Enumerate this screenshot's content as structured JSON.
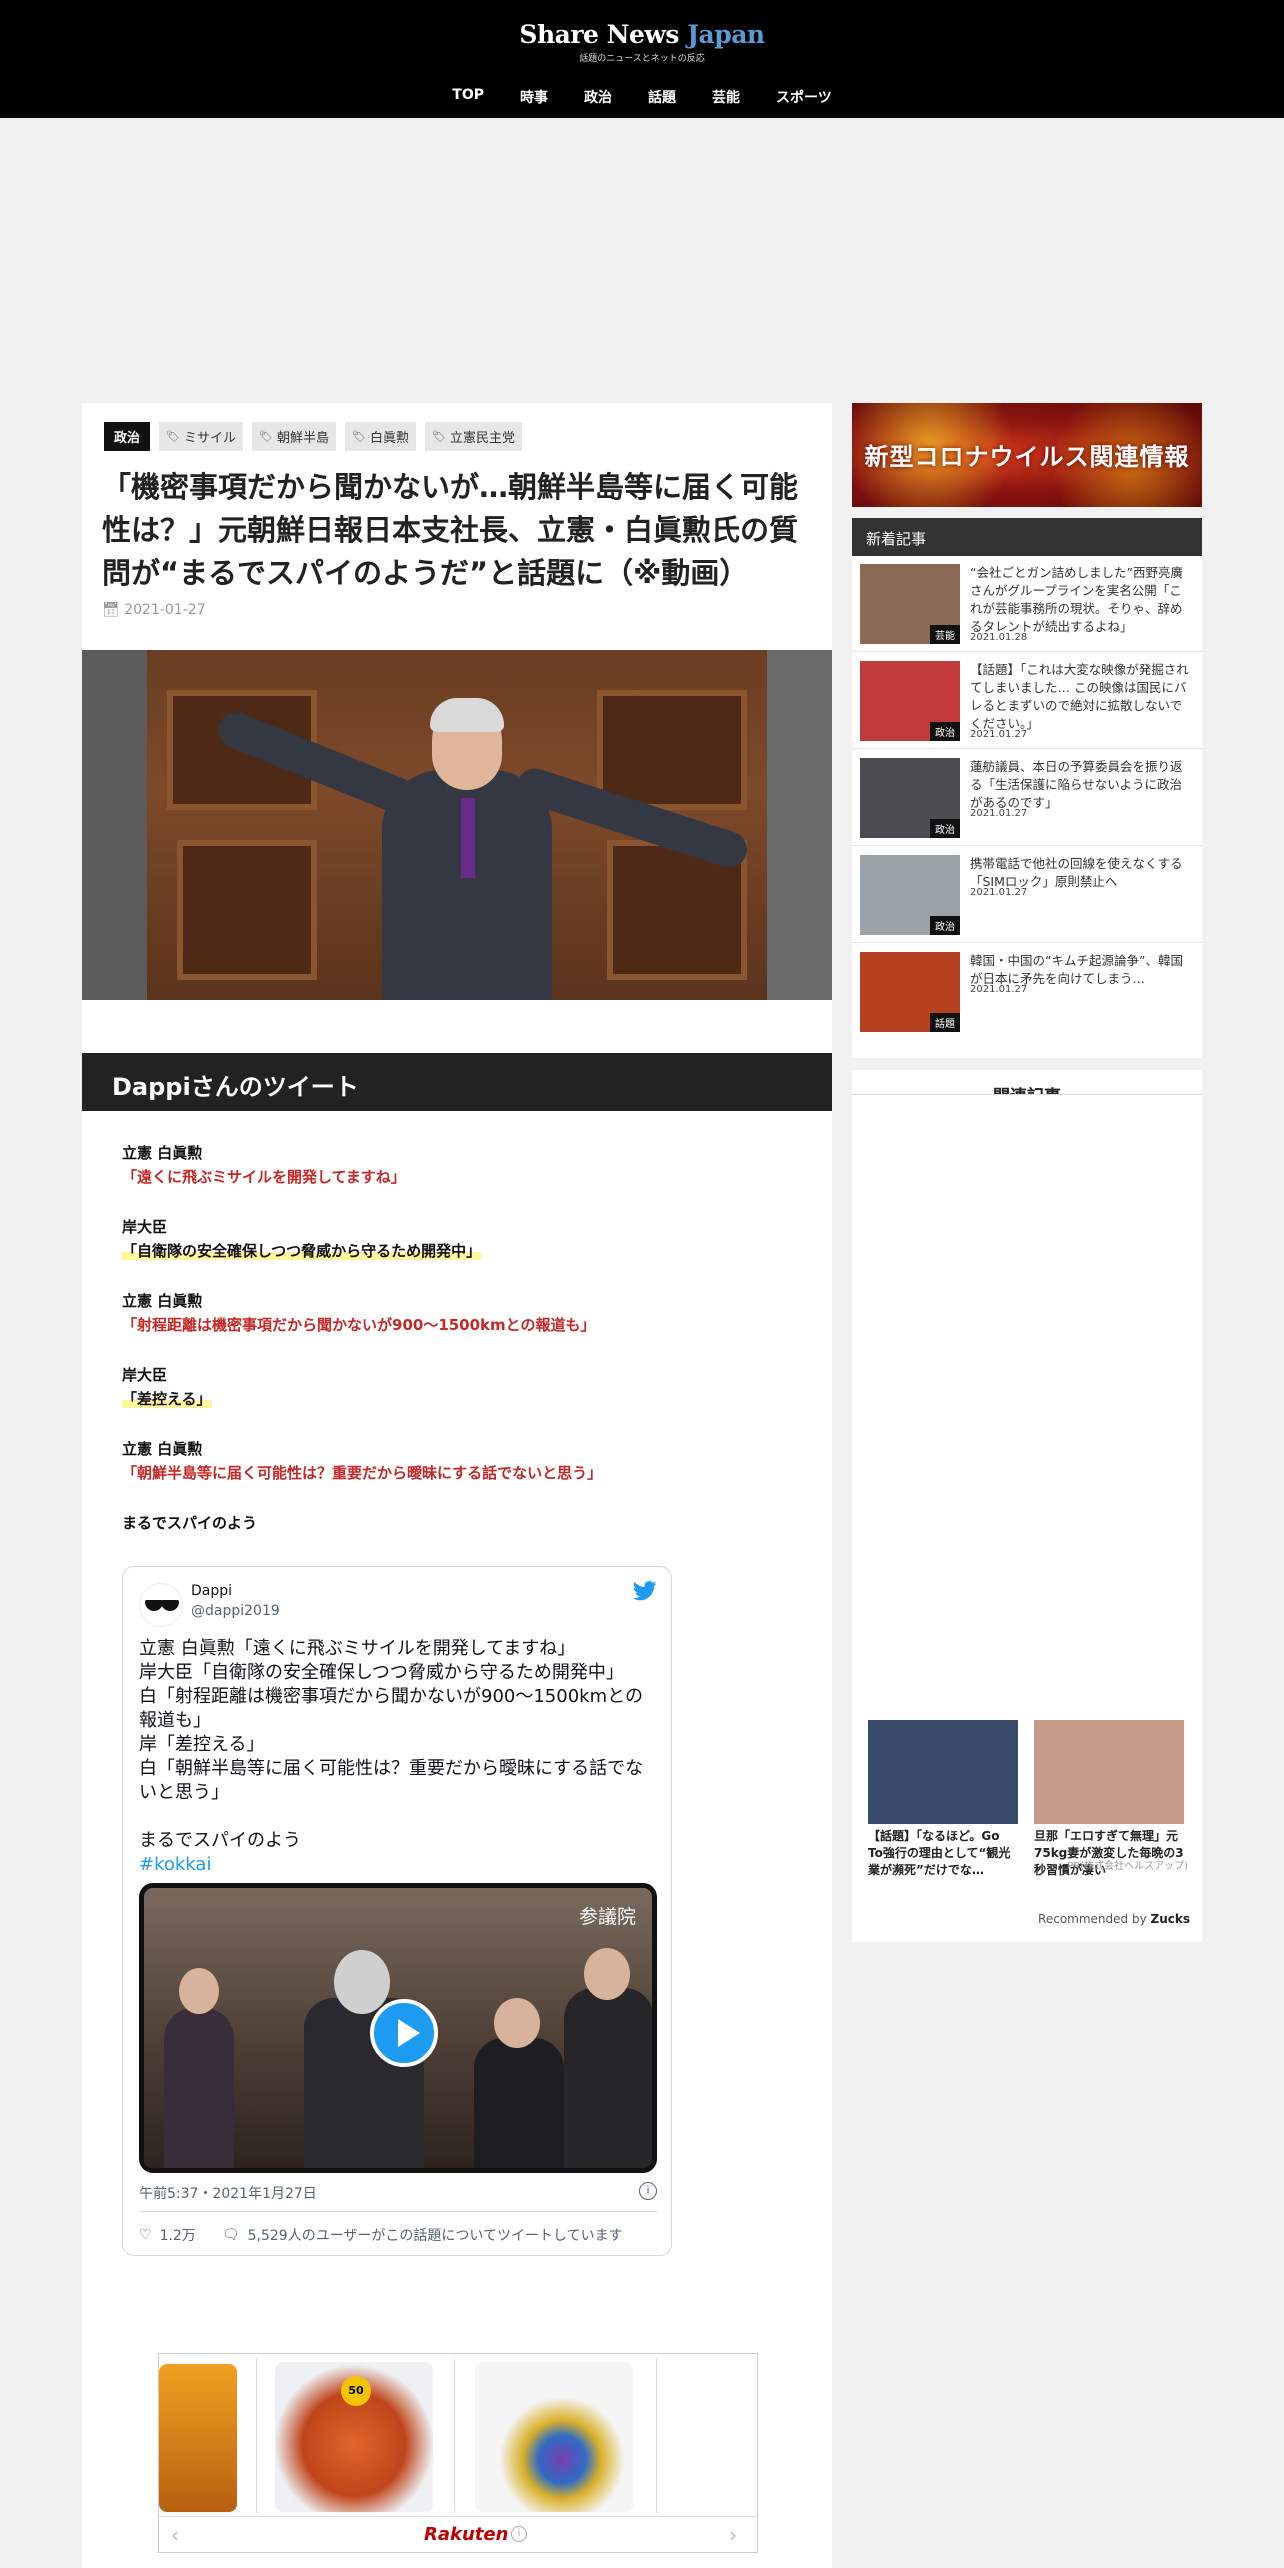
{
  "site": {
    "logo_main": "Share News ",
    "logo_accent": "Japan",
    "logo_sub": "話題のニュースとネットの反応"
  },
  "nav": [
    "TOP",
    "時事",
    "政治",
    "話題",
    "芸能",
    "スポーツ"
  ],
  "article": {
    "category": "政治",
    "tags": [
      "ミサイル",
      "朝鮮半島",
      "白眞勲",
      "立憲民主党"
    ],
    "title": "「機密事項だから聞かないが…朝鮮半島等に届く可能性は？」元朝鮮日報日本支社長、立憲・白眞勲氏の質問が“まるでスパイのようだ”と話題に（※動画）",
    "date": "2021-01-27",
    "section_heading": "Dappiさんのツイート",
    "dialog": [
      {
        "speaker": "立憲 白眞勲",
        "quote": "「遠くに飛ぶミサイルを開発してますね」",
        "color": "red",
        "highlight": false
      },
      {
        "speaker": "岸大臣",
        "quote": "「自衛隊の安全確保しつつ脅威から守るため開発中」",
        "color": "black",
        "highlight": true
      },
      {
        "speaker": "立憲 白眞勲",
        "quote": "「射程距離は機密事項だから聞かないが900～1500kmとの報道も」",
        "color": "red",
        "highlight": false
      },
      {
        "speaker": "岸大臣",
        "quote": "「差控える」",
        "color": "black",
        "highlight": true
      },
      {
        "speaker": "立憲 白眞勲",
        "quote": "「朝鮮半島等に届く可能性は？重要だから曖昧にする話でないと思う」",
        "color": "red",
        "highlight": false
      }
    ],
    "closing": "まるでスパイのよう"
  },
  "tweet": {
    "name": "Dappi",
    "handle": "@dappi2019",
    "lines": [
      "立憲 白眞勲「遠くに飛ぶミサイルを開発してますね」",
      "岸大臣「自衛隊の安全確保しつつ脅威から守るため開発中」",
      "白「射程距離は機密事項だから聞かないが900～1500kmとの報道も」",
      "岸「差控える」",
      "白「朝鮮半島等に届く可能性は？重要だから曖昧にする話でないと思う」",
      "",
      "まるでスパイのよう"
    ],
    "hashtag": "#kokkai",
    "video_label": "参議院",
    "timestamp": "午前5:37・2021年1月27日",
    "likes": "1.2万",
    "discussion": "5,529人のユーザーがこの話題についてツイートしています"
  },
  "ad": {
    "brand": "Rakuten",
    "badge": "50"
  },
  "sidebar": {
    "banner": "新型コロナウイルス関連情報",
    "new_heading": "新着記事",
    "news": [
      {
        "title": "“会社ごとガン詰めしました”西野亮廣さんがグループラインを実名公開「これが芸能事務所の現状。そりゃ、辞めるタレントが続出するよね」",
        "date": "2021.01.28",
        "cat": "芸能",
        "color": "#8a6a52"
      },
      {
        "title": "【話題】「これは大変な映像が発掘されてしまいました… この映像は国民にバレるとまずいので絶対に拡散しないでください。」",
        "date": "2021.01.27",
        "cat": "政治",
        "color": "#c23a3a"
      },
      {
        "title": "蓮舫議員、本日の予算委員会を振り返る「生活保護に陥らせないように政治があるのです」",
        "date": "2021.01.27",
        "cat": "政治",
        "color": "#4c4c52"
      },
      {
        "title": "携帯電話で他社の回線を使えなくする「SIMロック」原則禁止へ",
        "date": "2021.01.27",
        "cat": "政治",
        "color": "#9aa2a8"
      },
      {
        "title": "韓国・中国の“キムチ起源論争”、韓国が日本に矛先を向けてしまう…",
        "date": "2021.01.27",
        "cat": "話題",
        "color": "#b5411f"
      }
    ],
    "related_heading": "関連記事",
    "recommend": [
      {
        "caption": "【話題】「なるほど。Go To強行の理由として“観光業が瀕死”だけでな…",
        "color": "#3a4a6a"
      },
      {
        "caption": "旦那「エロすぎて無理」元75kg妻が激変した毎晩の3秒習慣が凄い",
        "color": "#c59a86"
      }
    ],
    "pr_label": "PR(株式会社ヘルスアップ)",
    "recommended_by": "Recommended by",
    "recommended_brand": "Zucks"
  }
}
